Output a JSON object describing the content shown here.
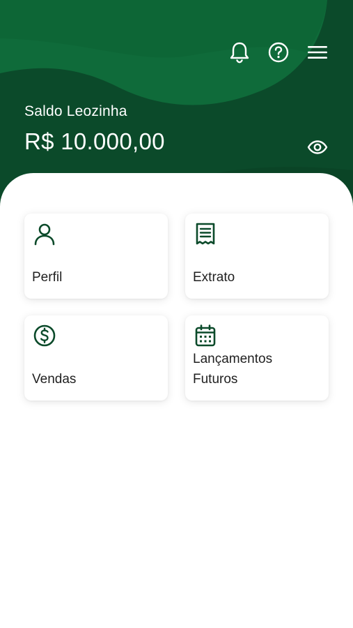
{
  "header": {
    "balance_label": "Saldo Leozinha",
    "balance_value": "R$ 10.000,00",
    "icons": [
      "bell-icon",
      "help-circle-icon",
      "menu-icon"
    ],
    "visibility_icon": "eye-icon"
  },
  "cards": [
    {
      "label": "Perfil",
      "icon": "user-icon"
    },
    {
      "label": "Extrato",
      "icon": "receipt-icon"
    },
    {
      "label": "Vendas",
      "icon": "dollar-circle-icon"
    },
    {
      "label": "Lançamentos\nFuturos",
      "icon": "calendar-icon"
    }
  ],
  "colors": {
    "header_dark": "#0b4a2a",
    "header_wave": "#0f6b3a",
    "icon_green": "#0b4a2a",
    "background": "#ffffff",
    "text": "#1f1f1f"
  }
}
